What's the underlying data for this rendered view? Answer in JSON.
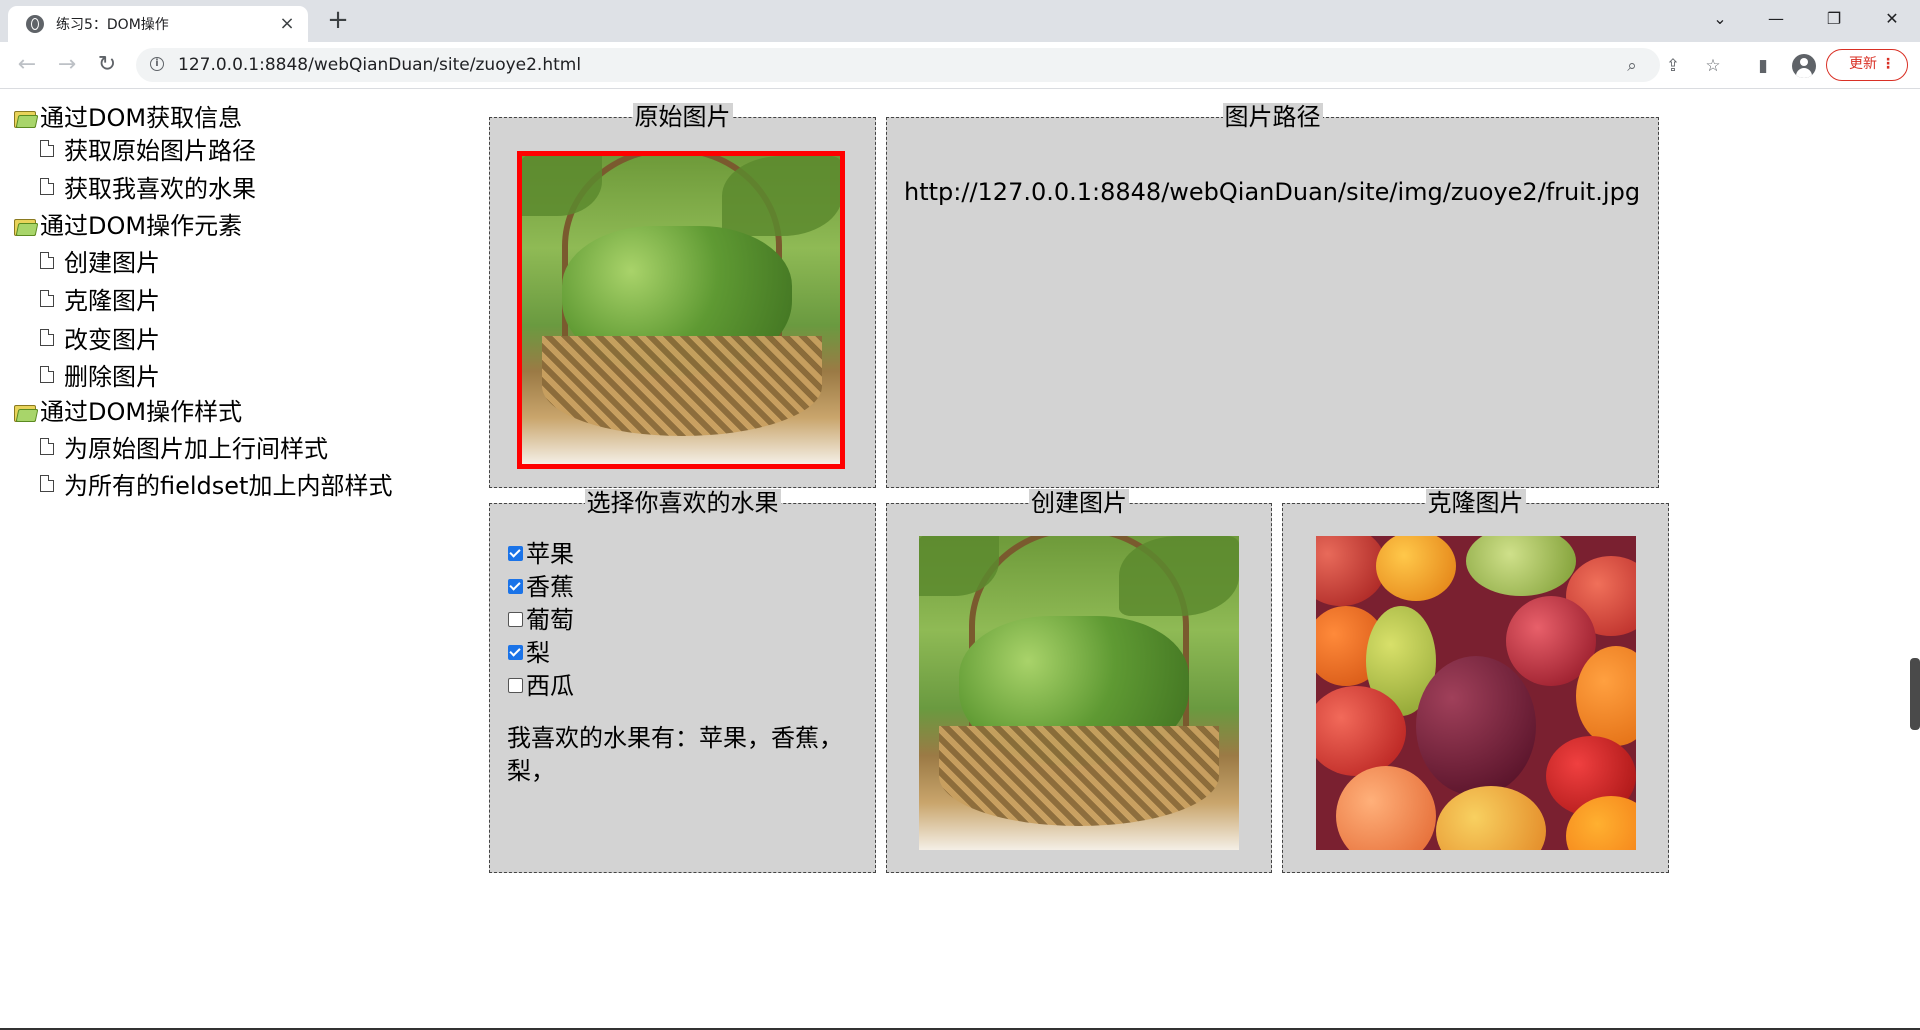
{
  "browser": {
    "tab_title": "练习5：DOM操作",
    "tab_close": "×",
    "new_tab": "+",
    "url": "127.0.0.1:8848/webQianDuan/site/zuoye2.html",
    "update_label": "更新",
    "update_menu": "⋮",
    "window_controls": [
      "⌄",
      "—",
      "❐",
      "✕"
    ],
    "nav_icons": [
      "back-arrow-icon",
      "forward-arrow-icon",
      "reload-icon"
    ],
    "toolbar_icons": [
      "zoom-icon",
      "share-icon",
      "star-icon",
      "sidebar-icon",
      "profile-icon"
    ]
  },
  "tree": {
    "groups": [
      {
        "label": "通过DOM获取信息",
        "items": [
          "获取原始图片路径",
          "获取我喜欢的水果"
        ]
      },
      {
        "label": "通过DOM操作元素",
        "items": [
          "创建图片",
          "克隆图片",
          "改变图片",
          "删除图片"
        ]
      },
      {
        "label": "通过DOM操作样式",
        "items": [
          "为原始图片加上行间样式",
          "为所有的fieldset加上内部样式"
        ]
      }
    ]
  },
  "panels": {
    "original": {
      "legend": "原始图片"
    },
    "path": {
      "legend": "图片路径",
      "value": "http://127.0.0.1:8848/webQianDuan/site/img/zuoye2/fruit.jpg"
    },
    "choose": {
      "legend": "选择你喜欢的水果",
      "options": [
        {
          "label": "苹果",
          "checked": true
        },
        {
          "label": "香蕉",
          "checked": true
        },
        {
          "label": "葡萄",
          "checked": false
        },
        {
          "label": "梨",
          "checked": true
        },
        {
          "label": "西瓜",
          "checked": false
        }
      ],
      "result": "我喜欢的水果有：苹果，香蕉，梨，"
    },
    "create": {
      "legend": "创建图片"
    },
    "clone": {
      "legend": "克隆图片"
    }
  },
  "colors": {
    "fieldset_bg": "#d3d3d3",
    "highlight_border": "#ff0000",
    "update_red": "#d93025"
  }
}
